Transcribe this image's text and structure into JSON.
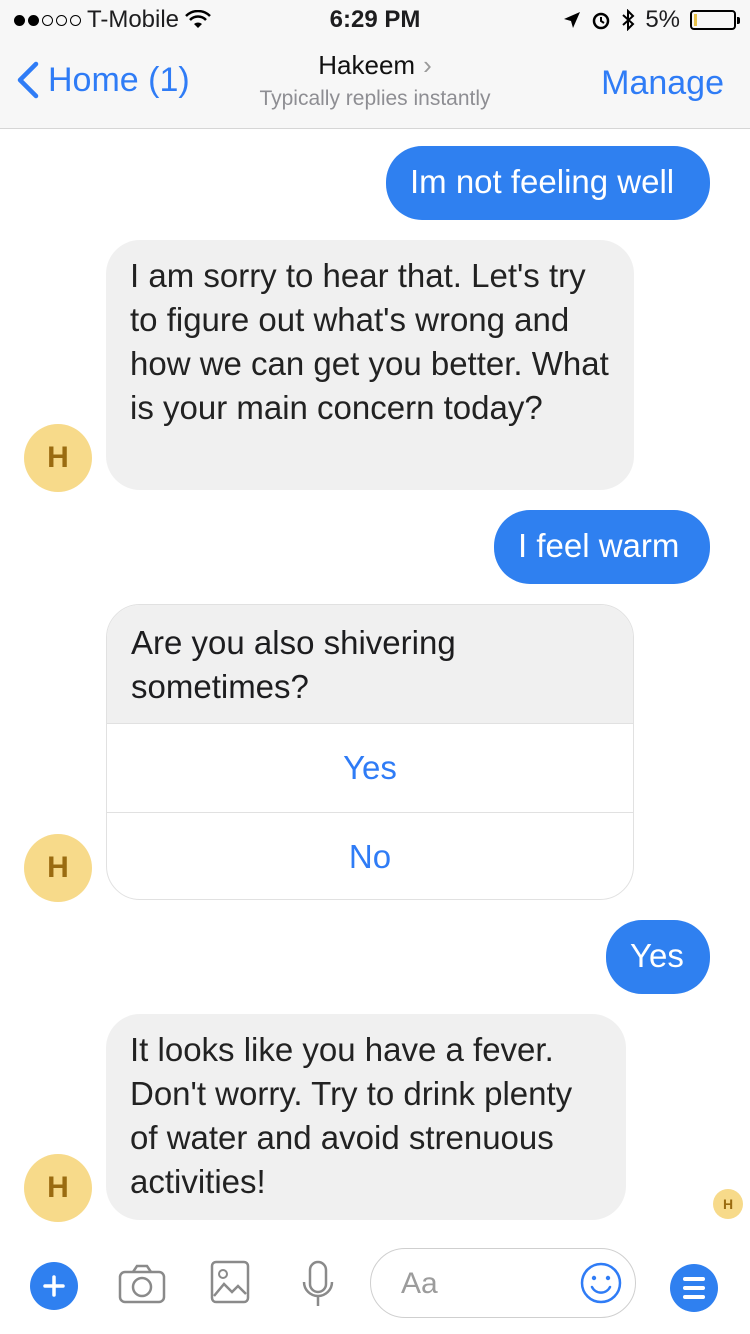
{
  "status_bar": {
    "carrier": "T-Mobile",
    "time": "6:29 PM",
    "battery": "5%",
    "signal_icon": "signal-dots-icon",
    "wifi_icon": "wifi-icon",
    "location_icon": "location-arrow-icon",
    "alarm_icon": "alarm-icon",
    "bluetooth_icon": "bluetooth-icon"
  },
  "nav": {
    "back_label": "Home (1)",
    "title": "Hakeem",
    "subtitle": "Typically replies instantly",
    "manage_label": "Manage"
  },
  "messages": [
    {
      "from": "user",
      "text": "Im not feeling well"
    },
    {
      "from": "bot",
      "text": "I am sorry to hear that. Let's try to figure out what's wrong and how we can get you better. What is your main concern today?"
    },
    {
      "from": "user",
      "text": "I feel warm"
    },
    {
      "from": "bot",
      "text": "Are you also shivering sometimes?",
      "options": [
        "Yes",
        "No"
      ]
    },
    {
      "from": "user",
      "text": "Yes"
    },
    {
      "from": "bot",
      "text": "It looks like you have a fever. Don't worry. Try to drink plenty of water and avoid strenuous activities!"
    }
  ],
  "avatar": {
    "initial": "H"
  },
  "input": {
    "placeholder": "Aa"
  },
  "colors": {
    "accent": "#2f80f0",
    "avatar_bg": "#f7da8a",
    "bubble_in": "#f0f0f0"
  }
}
